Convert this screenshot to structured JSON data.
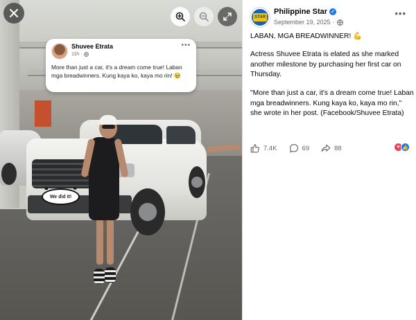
{
  "viewer": {
    "close_icon": "close-icon",
    "tools": [
      "zoom-in-icon",
      "zoom-out-icon",
      "fullscreen-icon"
    ],
    "overlay_post": {
      "author": "Shuvee Etrata",
      "time": "11h",
      "audience_icon": "globe-icon",
      "text": "More than just a car, it's a dream come true! Laban mga breadwinners. Kung kaya ko, kaya mo rin! 🥹"
    },
    "sticker_text": "We did it!"
  },
  "post": {
    "page_name": "Philippine Star",
    "logo_text": "STAR",
    "verified": true,
    "date": "September 19, 2025",
    "audience_icon": "globe-icon",
    "title": "LABAN, MGA BREADWINNER! 💪",
    "paragraph_1": "Actress Shuvee Etrata is elated as she marked another milestone by purchasing her first car on Thursday.",
    "paragraph_2": "\"More than just a car, it's a dream come true! Laban mga breadwinners. Kung kaya ko, kaya mo rin,\" she wrote in her post. (Facebook/Shuvee Etrata)",
    "likes": "7.4K",
    "comments": "69",
    "shares": "88",
    "reactions": [
      "heart",
      "like"
    ]
  },
  "colors": {
    "accent": "#1877f2",
    "heart": "#f33e58",
    "secondary_text": "#65676b"
  }
}
